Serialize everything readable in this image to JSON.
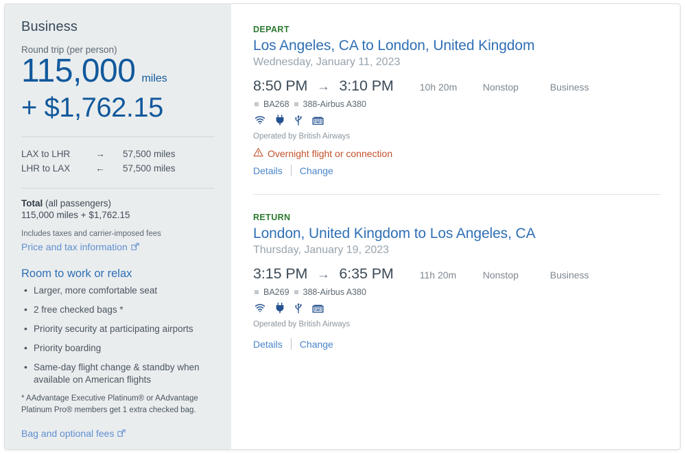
{
  "sidebar": {
    "cabin_title": "Business",
    "roundtrip_label": "Round trip (per person)",
    "miles_number": "115,000",
    "miles_unit": "miles",
    "price": "+ $1,762.15",
    "legs": [
      {
        "route": "LAX to LHR",
        "arrow": "→",
        "miles": "57,500 miles"
      },
      {
        "route": "LHR to LAX",
        "arrow": "←",
        "miles": "57,500 miles"
      }
    ],
    "total_label_bold": "Total",
    "total_label_rest": " (all passengers)",
    "total_value": "115,000 miles + $1,762.15",
    "taxes_note": "Includes taxes and carrier-imposed fees",
    "price_tax_link": "Price and tax information",
    "perks_title": "Room to work or relax",
    "perks": [
      "Larger, more comfortable seat",
      "2 free checked bags *",
      "Priority security at participating airports",
      "Priority boarding",
      "Same-day flight change & standby when available on American flights"
    ],
    "footnote": "* AAdvantage Executive Platinum® or AAdvantage Platinum Pro® members get 1 extra checked bag.",
    "bag_fees_link": "Bag and optional fees",
    "external_link_icon": "external-link-icon"
  },
  "flights": [
    {
      "kicker": "DEPART",
      "route": "Los Angeles, CA to London, United Kingdom",
      "date": "Wednesday, January 11, 2023",
      "depart_time": "8:50 PM",
      "arrow": "→",
      "arrive_time": "3:10 PM",
      "duration": "10h 20m",
      "stops": "Nonstop",
      "cabin": "Business",
      "flight_number": "BA268",
      "aircraft": "388-Airbus A380",
      "amenities": [
        "wifi-icon",
        "power-outlet-icon",
        "usb-port-icon",
        "entertainment-icon"
      ],
      "operated_by": "Operated by British Airways",
      "warning": "Overnight flight or connection",
      "warning_icon": "warning-triangle-icon",
      "details_link": "Details",
      "change_link": "Change"
    },
    {
      "kicker": "RETURN",
      "route": "London, United Kingdom to Los Angeles, CA",
      "date": "Thursday, January 19, 2023",
      "depart_time": "3:15 PM",
      "arrow": "→",
      "arrive_time": "6:35 PM",
      "duration": "11h 20m",
      "stops": "Nonstop",
      "cabin": "Business",
      "flight_number": "BA269",
      "aircraft": "388-Airbus A380",
      "amenities": [
        "wifi-icon",
        "power-outlet-icon",
        "usb-port-icon",
        "entertainment-icon"
      ],
      "operated_by": "Operated by British Airways",
      "warning": null,
      "warning_icon": null,
      "details_link": "Details",
      "change_link": "Change"
    }
  ],
  "colors": {
    "brand_blue": "#11599c",
    "link_blue": "#4a84c8",
    "heading_blue": "#2f6fb5",
    "kicker_green": "#2c7a2f",
    "warning_orange": "#c0502a",
    "sidebar_bg": "#eaedee"
  }
}
